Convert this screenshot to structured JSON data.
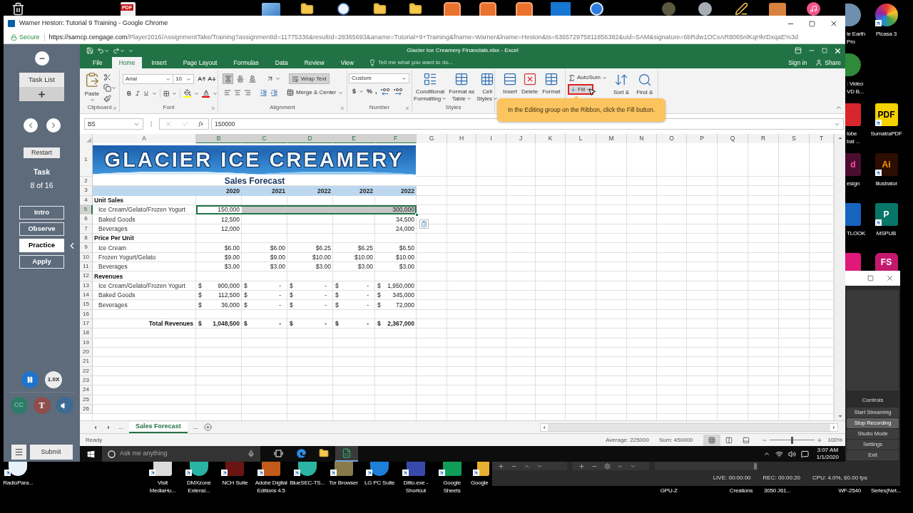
{
  "desktop": {
    "top_badge": "PDF",
    "right_icons": [
      {
        "left": {
          "kind": "shortcut",
          "label": "le Earth\nPro"
        },
        "right": {
          "kind": "shortcut",
          "label": "Picasa 3"
        }
      },
      {
        "left": {
          "kind": "shortcut",
          "label": ": Video\nVD B..."
        }
      },
      {
        "left": {
          "kind": "shortcut",
          "label": "lobe\nbat ..."
        },
        "right": {
          "kind": "shortcut",
          "label": "SumatraPDF",
          "glyph": "PDF"
        }
      },
      {
        "left": {
          "kind": "shortcut",
          "label": "esign",
          "glyph": "d"
        },
        "right": {
          "kind": "shortcut",
          "label": "Illustrator",
          "glyph": "Ai"
        }
      },
      {
        "left": {
          "kind": "shortcut",
          "label": "TLOOK"
        },
        "right": {
          "kind": "shortcut",
          "label": "MSPUB",
          "glyph": "P"
        }
      },
      {
        "left": {
          "kind": "tile"
        },
        "right": {
          "kind": "tile",
          "glyph": "FS"
        }
      }
    ],
    "bottom_icons": [
      {
        "kind": "shortcut",
        "label": "RadioPara..."
      },
      {
        "kind": "shortcut",
        "label": "Visit\nMediaHu..."
      },
      {
        "kind": "shortcut",
        "label": "DMXzone\nExtensi..."
      },
      {
        "kind": "shortcut",
        "label": "NCH Suite"
      },
      {
        "kind": "shortcut",
        "label": "Adobe Digital\nEditions 4.5"
      },
      {
        "kind": "shortcut",
        "label": "BlueSEC-TS..."
      },
      {
        "kind": "shortcut",
        "label": "Tor Browser"
      },
      {
        "kind": "shortcut",
        "label": "LG PC Suite"
      },
      {
        "kind": "shortcut",
        "label": "Ditto.exe -\nShortcut"
      },
      {
        "kind": "shortcut",
        "label": "Google\nSheets"
      },
      {
        "kind": "partial",
        "label": "Google"
      },
      {
        "kind": "covered",
        "label": "GPU-Z"
      },
      {
        "kind": "covered",
        "label": "Creations"
      },
      {
        "kind": "covered",
        "label": "3050 J61..."
      },
      {
        "kind": "covered",
        "label": "WF-2540"
      },
      {
        "kind": "covered",
        "label": "Series(Net..."
      }
    ]
  },
  "browser": {
    "title": "Warner Heston: Tutorial 9 Training - Google Chrome",
    "security": "Secure",
    "url_host": "https://samcp.cengage.com",
    "url_path": "/Player2016/AssignmentTake/Training?assignmentId=11775336&resultId=28365693&aname=Tutorial+9+Training&fname=Warner&lname=Heston&ts=636572975811856382&uid=SAM&signature=6bRdw1OCxAR8065nlKqHkrDxqaE%3d"
  },
  "task_panel": {
    "task_list": "Task List",
    "restart": "Restart",
    "task_title": "Task",
    "task_progress": "8 of 16",
    "modes": [
      {
        "label": "Intro",
        "selected": false
      },
      {
        "label": "Observe",
        "selected": false
      },
      {
        "label": "Practice",
        "selected": true
      },
      {
        "label": "Apply",
        "selected": false
      }
    ],
    "speed": "1.0X",
    "captions": "CC",
    "transcript": "T",
    "submit": "Submit"
  },
  "excel": {
    "title": "Glacier Ice Creamery Financials.xlsx - Excel",
    "tabs": [
      {
        "label": "File",
        "selected": false
      },
      {
        "label": "Home",
        "selected": true
      },
      {
        "label": "Insert",
        "selected": false
      },
      {
        "label": "Page Layout",
        "selected": false
      },
      {
        "label": "Formulas",
        "selected": false
      },
      {
        "label": "Data",
        "selected": false
      },
      {
        "label": "Review",
        "selected": false
      },
      {
        "label": "View",
        "selected": false
      }
    ],
    "tell_me": {
      "placeholder": "Tell me what you want to do..."
    },
    "sign_in": "Sign in",
    "share": "Share",
    "ribbon": {
      "clipboard": {
        "paste": "Paste",
        "label": "Clipboard"
      },
      "font": {
        "name": "Arial",
        "size": "10",
        "label": "Font"
      },
      "alignment": {
        "vertical": [
          {
            "selected": true
          },
          {
            "selected": false
          },
          {
            "selected": false
          }
        ],
        "wrap_text": {
          "label": "Wrap Text",
          "on": true
        },
        "merge": "Merge & Center",
        "label": "Alignment"
      },
      "number": {
        "format": "Custom",
        "symbols": [
          "$",
          "%",
          ","
        ],
        "label": "Number"
      },
      "styles": {
        "buttons": [
          "Conditional\nFormatting",
          "Format as\nTable",
          "Cell\nStyles"
        ],
        "label": "Styles"
      },
      "cells": {
        "buttons": [
          "Insert",
          "Delete",
          "Format"
        ]
      },
      "editing": {
        "autosum": "AutoSum",
        "fill": {
          "label": "Fill",
          "highlighted": true
        },
        "sort": "Sort &",
        "find": "Find &"
      }
    },
    "callout": "In the Editing group on the Ribbon, click the Fill button."
  },
  "sheet": {
    "name_box": "B5",
    "fx": "fx",
    "formula": "150000",
    "quick_options": true,
    "banner": "GLACIER ICE CREAMERY",
    "columns": [
      {
        "label": "A",
        "selected": false
      },
      {
        "label": "B",
        "selected": true
      },
      {
        "label": "C",
        "selected": true
      },
      {
        "label": "D",
        "selected": true
      },
      {
        "label": "E",
        "selected": true
      },
      {
        "label": "F",
        "selected": true
      },
      {
        "label": "G",
        "selected": false
      },
      {
        "label": "H",
        "selected": false
      },
      {
        "label": "I",
        "selected": false
      },
      {
        "label": "J",
        "selected": false
      },
      {
        "label": "K",
        "selected": false
      },
      {
        "label": "L",
        "selected": false
      },
      {
        "label": "M",
        "selected": false
      },
      {
        "label": "N",
        "selected": false
      },
      {
        "label": "O",
        "selected": false
      },
      {
        "label": "P",
        "selected": false
      },
      {
        "label": "Q",
        "selected": false
      },
      {
        "label": "R",
        "selected": false
      },
      {
        "label": "S",
        "selected": false
      },
      {
        "label": "T",
        "selected": false
      }
    ],
    "rows": [
      {
        "number": "1",
        "selected": false,
        "kind": "banner"
      },
      {
        "number": "2",
        "selected": false,
        "kind": "title",
        "title": "Sales Forecast"
      },
      {
        "number": "3",
        "selected": false,
        "kind": "years",
        "cells": [
          {
            "value": "2020",
            "selected": false,
            "active": false
          },
          {
            "value": "2021",
            "selected": false,
            "active": false
          },
          {
            "value": "2022",
            "selected": false,
            "active": false
          },
          {
            "value": "2022",
            "selected": false,
            "active": false
          },
          {
            "value": "2022",
            "selected": false,
            "active": false
          }
        ]
      },
      {
        "number": "4",
        "selected": false,
        "kind": "section",
        "label": "Unit Sales"
      },
      {
        "number": "5",
        "selected": true,
        "kind": "item",
        "label": "Ice Cream/Gelato/Frozen Yogurt",
        "cells": [
          {
            "value": "150,000",
            "selected": true,
            "active": true
          },
          {
            "selected": true,
            "active": false
          },
          {
            "selected": true,
            "active": false
          },
          {
            "selected": true,
            "active": false
          },
          {
            "value": "300,000",
            "selected": true,
            "active": false
          }
        ]
      },
      {
        "number": "6",
        "selected": false,
        "kind": "item",
        "label": "Baked Goods",
        "cells": [
          {
            "value": "12,500",
            "selected": false,
            "active": false
          },
          {
            "selected": false,
            "active": false
          },
          {
            "selected": false,
            "active": false
          },
          {
            "selected": false,
            "active": false
          },
          {
            "value": "34,500",
            "selected": false,
            "active": false
          }
        ]
      },
      {
        "number": "7",
        "selected": false,
        "kind": "item",
        "label": "Beverages",
        "cells": [
          {
            "value": "12,000",
            "selected": false,
            "active": false
          },
          {
            "selected": false,
            "active": false
          },
          {
            "selected": false,
            "active": false
          },
          {
            "selected": false,
            "active": false
          },
          {
            "value": "24,000",
            "selected": false,
            "active": false
          }
        ]
      },
      {
        "number": "8",
        "selected": false,
        "kind": "section",
        "label": "Price Per Unit"
      },
      {
        "number": "9",
        "selected": false,
        "kind": "item",
        "label": "Ice Cream",
        "cells": [
          {
            "value": "$6.00",
            "selected": false,
            "active": false
          },
          {
            "value": "$6.00",
            "selected": false,
            "active": false
          },
          {
            "value": "$6.25",
            "selected": false,
            "active": false
          },
          {
            "value": "$6.25",
            "selected": false,
            "active": false
          },
          {
            "value": "$6.50",
            "selected": false,
            "active": false
          }
        ]
      },
      {
        "number": "10",
        "selected": false,
        "kind": "item",
        "label": "Frozen Yogurt/Gelato",
        "cells": [
          {
            "value": "$9.00",
            "selected": false,
            "active": false
          },
          {
            "value": "$9.00",
            "selected": false,
            "active": false
          },
          {
            "value": "$10.00",
            "selected": false,
            "active": false
          },
          {
            "value": "$10.00",
            "selected": false,
            "active": false
          },
          {
            "value": "$10.00",
            "selected": false,
            "active": false
          }
        ]
      },
      {
        "number": "11",
        "selected": false,
        "kind": "item",
        "label": "Beverages",
        "cells": [
          {
            "value": "$3.00",
            "selected": false,
            "active": false
          },
          {
            "value": "$3.00",
            "selected": false,
            "active": false
          },
          {
            "value": "$3.00",
            "selected": false,
            "active": false
          },
          {
            "value": "$3.00",
            "selected": false,
            "active": false
          },
          {
            "value": "$3.00",
            "selected": false,
            "active": false
          }
        ]
      },
      {
        "number": "12",
        "selected": false,
        "kind": "section",
        "label": "Revenues"
      },
      {
        "number": "13",
        "selected": false,
        "kind": "item",
        "label": "Ice Cream/Gelato/Frozen Yogurt",
        "cells": [
          {
            "symbol": "$",
            "value": "900,000",
            "selected": false,
            "active": false
          },
          {
            "symbol": "$",
            "value": "-",
            "selected": false,
            "active": false
          },
          {
            "symbol": "$",
            "value": "-",
            "selected": false,
            "active": false
          },
          {
            "symbol": "$",
            "value": "-",
            "selected": false,
            "active": false
          },
          {
            "symbol": "$",
            "value": "1,950,000",
            "selected": false,
            "active": false
          }
        ]
      },
      {
        "number": "14",
        "selected": false,
        "kind": "item",
        "label": "Baked Goods",
        "cells": [
          {
            "symbol": "$",
            "value": "112,500",
            "selected": false,
            "active": false
          },
          {
            "symbol": "$",
            "value": "-",
            "selected": false,
            "active": false
          },
          {
            "symbol": "$",
            "value": "-",
            "selected": false,
            "active": false
          },
          {
            "symbol": "$",
            "value": "-",
            "selected": false,
            "active": false
          },
          {
            "symbol": "$",
            "value": "345,000",
            "selected": false,
            "active": false
          }
        ]
      },
      {
        "number": "15",
        "selected": false,
        "kind": "item",
        "label": "Beverages",
        "cells": [
          {
            "symbol": "$",
            "value": "36,000",
            "selected": false,
            "active": false
          },
          {
            "symbol": "$",
            "value": "-",
            "selected": false,
            "active": false
          },
          {
            "symbol": "$",
            "value": "-",
            "selected": false,
            "active": false
          },
          {
            "symbol": "$",
            "value": "-",
            "selected": false,
            "active": false
          },
          {
            "symbol": "$",
            "value": "72,000",
            "selected": false,
            "active": false
          }
        ]
      },
      {
        "number": "16",
        "selected": false,
        "kind": "empty"
      },
      {
        "number": "17",
        "selected": false,
        "kind": "total",
        "label": "Total Revenues",
        "cells": [
          {
            "symbol": "$",
            "value": "1,048,500",
            "selected": false,
            "active": false
          },
          {
            "symbol": "$",
            "value": "-",
            "selected": false,
            "active": false
          },
          {
            "symbol": "$",
            "value": "-",
            "selected": false,
            "active": false
          },
          {
            "symbol": "$",
            "value": "-",
            "selected": false,
            "active": false
          },
          {
            "symbol": "$",
            "value": "2,367,000",
            "selected": false,
            "active": false
          }
        ]
      },
      {
        "number": "18",
        "selected": false,
        "kind": "empty"
      },
      {
        "number": "19",
        "selected": false,
        "kind": "empty"
      },
      {
        "number": "20",
        "selected": false,
        "kind": "empty"
      },
      {
        "number": "21",
        "selected": false,
        "kind": "empty"
      },
      {
        "number": "22",
        "selected": false,
        "kind": "empty"
      },
      {
        "number": "23",
        "selected": false,
        "kind": "empty"
      },
      {
        "number": "24",
        "selected": false,
        "kind": "empty"
      },
      {
        "number": "25",
        "selected": false,
        "kind": "empty"
      },
      {
        "number": "26",
        "selected": false,
        "kind": "empty"
      }
    ]
  },
  "sheet_tabs": {
    "more_left": "...",
    "items": [
      {
        "label": "Sales Forecast",
        "selected": true
      }
    ],
    "more_right": "..."
  },
  "status": {
    "mode": "Ready",
    "average": "Average: 225000",
    "sum": "Sum: 450000",
    "views": [
      {
        "selected": true
      },
      {
        "selected": false
      },
      {
        "selected": false
      }
    ],
    "zoom": {
      "level": 0.5,
      "text": "100%"
    }
  },
  "taskbar": {
    "search": {
      "placeholder": "Ask me anything"
    },
    "apps": [
      {
        "active": false
      },
      {
        "active": false
      },
      {
        "active": false
      },
      {
        "active": true
      }
    ],
    "time": "3:07 AM",
    "date": "1/1/2020"
  },
  "obs": {
    "controls_title": "Controls",
    "buttons": [
      {
        "label": "Start Streaming",
        "highlighted": false
      },
      {
        "label": "Stop Recording",
        "highlighted": true
      },
      {
        "label": "Studio Mode",
        "highlighted": false
      },
      {
        "label": "Settings",
        "highlighted": false
      },
      {
        "label": "Exit",
        "highlighted": false
      }
    ],
    "status": [
      "LIVE: 00:00:00",
      "REC: 00:00:20",
      "CPU: 4.0%, 60.00 fps"
    ]
  }
}
